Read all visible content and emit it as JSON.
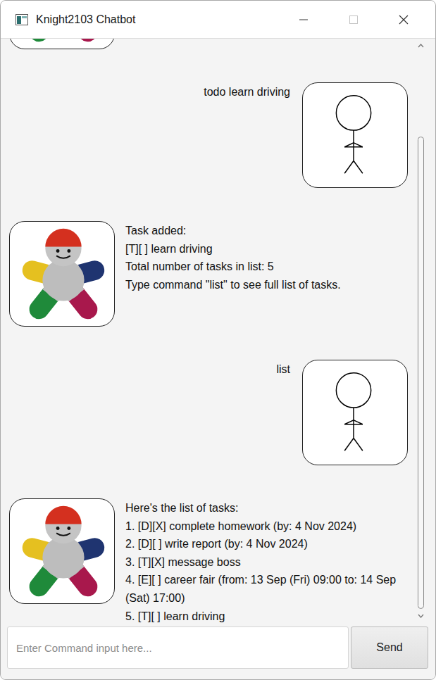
{
  "window": {
    "title": "Knight2103 Chatbot",
    "controls": [
      {
        "kind": "minimize",
        "disabled": false
      },
      {
        "kind": "maximize",
        "disabled": true
      },
      {
        "kind": "close",
        "disabled": false
      }
    ]
  },
  "messages": [
    {
      "kind": "bot",
      "lines": []
    },
    {
      "kind": "user",
      "lines": [
        "todo learn driving"
      ]
    },
    {
      "kind": "bot",
      "lines": [
        "Task added:",
        "[T][ ] learn driving",
        "Total number of tasks in list: 5",
        "Type command \"list\" to see full list of tasks."
      ]
    },
    {
      "kind": "user",
      "lines": [
        "list"
      ]
    },
    {
      "kind": "bot",
      "lines": [
        "Here's the list of tasks:",
        "1. [D][X] complete homework (by: 4 Nov 2024)",
        "2. [D][ ] write report (by: 4 Nov 2024)",
        "3. [T][X] message boss",
        "4. [E][ ] career fair (from: 13 Sep (Fri) 09:00 to: 14 Sep (Sat) 17:00)",
        "5. [T][ ] learn driving"
      ]
    }
  ],
  "scrollbar": {
    "level": 1
  },
  "input": {
    "placeholder": "Enter Command input here...",
    "value": ""
  },
  "send_button": {
    "label": "Send"
  }
}
